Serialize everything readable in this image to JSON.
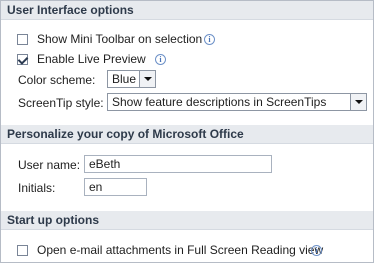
{
  "sections": {
    "ui_options": {
      "title": "User Interface options",
      "mini_toolbar": {
        "label": "Show Mini Toolbar on selection",
        "checked": false
      },
      "live_preview": {
        "label": "Enable Live Preview",
        "checked": true
      },
      "color_scheme": {
        "label": "Color scheme:",
        "value": "Blue"
      },
      "screentip_style": {
        "label": "ScreenTip style:",
        "value": "Show feature descriptions in ScreenTips"
      }
    },
    "personalize": {
      "title": "Personalize your copy of Microsoft Office",
      "user_name": {
        "label": "User name:",
        "value": "eBeth"
      },
      "initials": {
        "label": "Initials:",
        "value": "en"
      }
    },
    "startup": {
      "title": "Start up options",
      "email_attachments": {
        "label": "Open e-mail attachments in Full Screen Reading view",
        "checked": false
      }
    }
  },
  "info_glyph": "i"
}
